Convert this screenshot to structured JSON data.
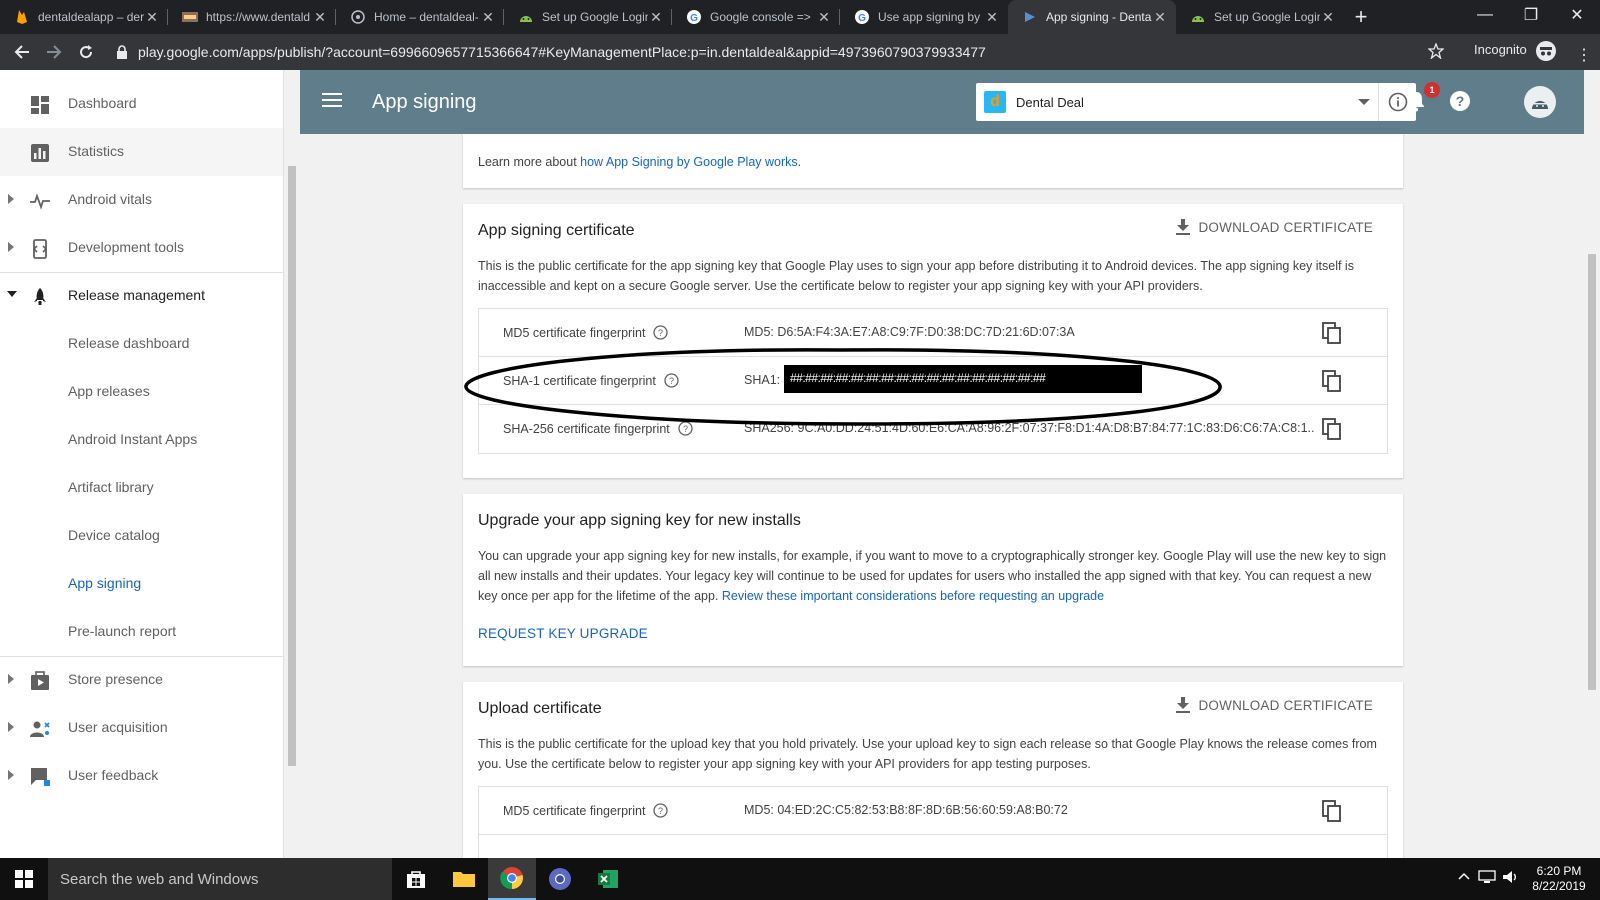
{
  "browser": {
    "tabs": [
      {
        "label": "dentaldealapp – der",
        "icon": "firebase-icon"
      },
      {
        "label": "https://www.dentald",
        "icon": "site-icon"
      },
      {
        "label": "Home – dentaldeal-",
        "icon": "globe-icon"
      },
      {
        "label": "Set up Google Login",
        "icon": "android-icon"
      },
      {
        "label": "Google console =>",
        "icon": "google-icon"
      },
      {
        "label": "Use app signing by",
        "icon": "google-icon"
      },
      {
        "label": "App signing - Denta",
        "icon": "play-console-icon"
      },
      {
        "label": "Set up Google Login",
        "icon": "android-icon"
      }
    ],
    "url": "play.google.com/apps/publish/?account=6996609657715366647#KeyManagementPlace:p=in.dentaldeal&appid=4973960790379933477",
    "incognito_label": "Incognito"
  },
  "sidebar": {
    "items": [
      {
        "label": "Dashboard",
        "icon": "dashboard-icon"
      },
      {
        "label": "Statistics",
        "icon": "statistics-icon"
      },
      {
        "label": "Android vitals",
        "icon": "vitals-icon"
      },
      {
        "label": "Development tools",
        "icon": "dev-tools-icon"
      },
      {
        "label": "Release management",
        "icon": "rocket-icon"
      },
      {
        "label": "Release dashboard"
      },
      {
        "label": "App releases"
      },
      {
        "label": "Android Instant Apps"
      },
      {
        "label": "Artifact library"
      },
      {
        "label": "Device catalog"
      },
      {
        "label": "App signing"
      },
      {
        "label": "Pre-launch report"
      },
      {
        "label": "Store presence",
        "icon": "store-icon"
      },
      {
        "label": "User acquisition",
        "icon": "user-acquisition-icon"
      },
      {
        "label": "User feedback",
        "icon": "feedback-icon"
      }
    ]
  },
  "header": {
    "title": "App signing",
    "app_name": "Dental Deal",
    "app_logo_letter": "d",
    "notification_count": "1"
  },
  "learn_more": {
    "prefix": "Learn more about ",
    "link": "how App Signing by Google Play works",
    "suffix": "."
  },
  "app_signing_cert": {
    "title": "App signing certificate",
    "download_label": "DOWNLOAD CERTIFICATE",
    "description": "This is the public certificate for the app signing key that Google Play uses to sign your app before distributing it to Android devices. The app signing key itself is inaccessible and kept on a secure Google server. Use the certificate below to register your app signing key with your API providers.",
    "rows": [
      {
        "label": "MD5 certificate fingerprint",
        "value": "MD5: D6:5A:F4:3A:E7:A8:C9:7F:D0:38:DC:7D:21:6D:07:3A"
      },
      {
        "label": "SHA-1 certificate fingerprint",
        "value": "SHA1: 4",
        "redacted": "##:##:##:##:##:##:##:##:##:##:##:##:##:##:##:##:##"
      },
      {
        "label": "SHA-256 certificate fingerprint",
        "value": "SHA256: 9C:A0:DD:24:51:4D:60:E6:CA:A8:96:2F:07:37:F8:D1:4A:D8:B7:84:77:1C:83:D6:C6:7A:C8:1..."
      }
    ]
  },
  "upgrade": {
    "title": "Upgrade your app signing key for new installs",
    "description": "You can upgrade your app signing key for new installs, for example, if you want to move to a cryptographically stronger key. Google Play will use the new key to sign all new installs and their updates. Your legacy key will continue to be used for updates for users who installed the app signed with that key. You can request a new key once per app for the lifetime of the app. ",
    "link": "Review these important considerations before requesting an upgrade",
    "request_label": "REQUEST KEY UPGRADE"
  },
  "upload_cert": {
    "title": "Upload certificate",
    "download_label": "DOWNLOAD CERTIFICATE",
    "description": "This is the public certificate for the upload key that you hold privately. Use your upload key to sign each release so that Google Play knows the release comes from you. Use the certificate below to register your app signing key with your API providers for app testing purposes.",
    "rows": [
      {
        "label": "MD5 certificate fingerprint",
        "value": "MD5: 04:ED:2C:C5:82:53:B8:8F:8D:6B:56:60:59:A8:B0:72"
      }
    ]
  },
  "taskbar": {
    "search_placeholder": "Search the web and Windows",
    "time": "6:20 PM",
    "date": "8/22/2019"
  },
  "colors": {
    "header": "#607d8b",
    "link": "#1565c0",
    "badge": "#d32f2f"
  }
}
